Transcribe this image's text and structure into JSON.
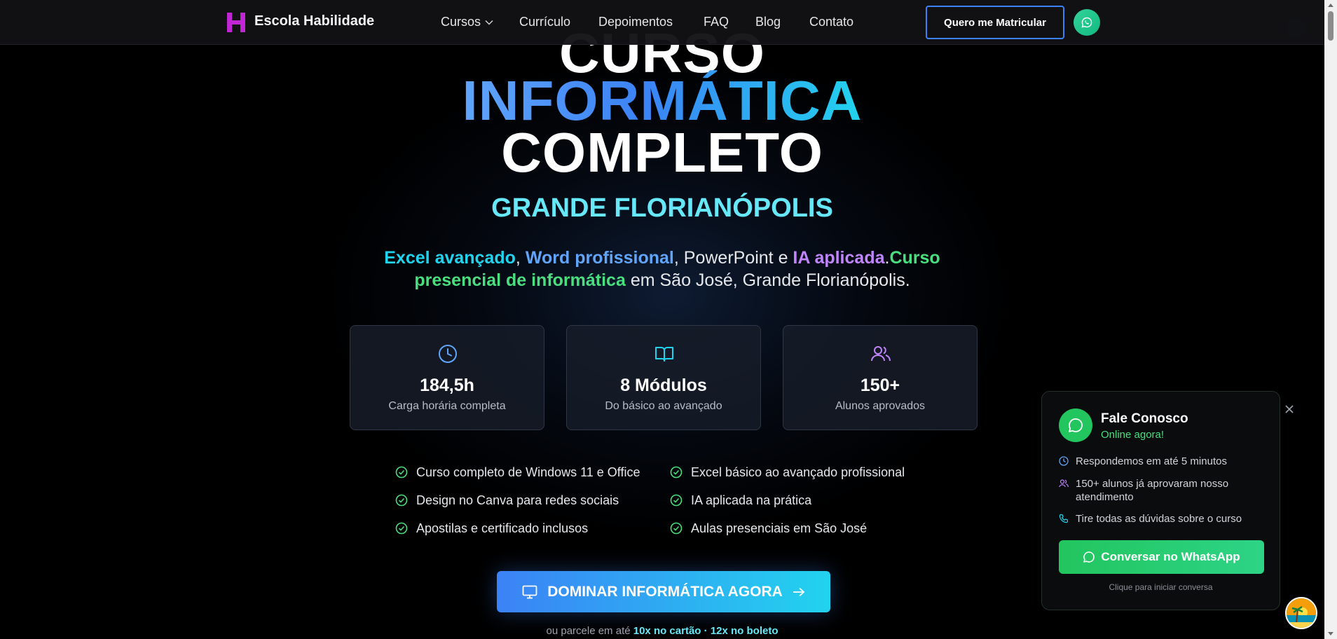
{
  "nav": {
    "brand": "Escola Habilidade",
    "links": [
      "Cursos",
      "Currículo",
      "Depoimentos",
      "FAQ",
      "Blog",
      "Contato"
    ],
    "cta": "Quero me Matricular"
  },
  "hero": {
    "line1": "CURSO",
    "line2": "INFORMÁTICA",
    "line3": "COMPLETO",
    "region": "GRANDE FLORIANÓPOLIS",
    "subtitle": {
      "excel": "Excel avançado",
      "sep1": ", ",
      "word": "Word profissional",
      "mid": ", PowerPoint e ",
      "ia": "IA aplicada",
      "dot": ".",
      "presencial": "Curso presencial de informática",
      "tail": " em São José, Grande Florianópolis."
    }
  },
  "stats": [
    {
      "icon": "clock-icon",
      "value": "184,5h",
      "label": "Carga horária completa"
    },
    {
      "icon": "book-open-icon",
      "value": "8 Módulos",
      "label": "Do básico ao avançado"
    },
    {
      "icon": "users-icon",
      "value": "150+",
      "label": "Alunos aprovados"
    }
  ],
  "features": [
    "Curso completo de Windows 11 e Office",
    "Excel básico ao avançado profissional",
    "Design no Canva para redes sociais",
    "IA aplicada na prática",
    "Apostilas e certificado inclusos",
    "Aulas presenciais em São José"
  ],
  "cta": {
    "label": "DOMINAR INFORMÁTICA AGORA",
    "installments_prefix": "ou parcele em até ",
    "installments_card": "10x no cartão",
    "installments_sep": " · ",
    "installments_boleto": "12x no boleto"
  },
  "chat": {
    "title": "Fale Conosco",
    "status": "Online agora!",
    "items": [
      "Respondemos em até 5 minutos",
      "150+ alunos já aprovaram nosso atendimento",
      "Tire todas as dúvidas sobre o curso"
    ],
    "button": "Conversar no WhatsApp",
    "hint": "Clique para iniciar conversa"
  },
  "colors": {
    "brand_purple": "#a21caf",
    "accent_blue": "#3b82f6",
    "accent_cyan": "#22d3ee",
    "whatsapp_green": "#22c55e"
  }
}
